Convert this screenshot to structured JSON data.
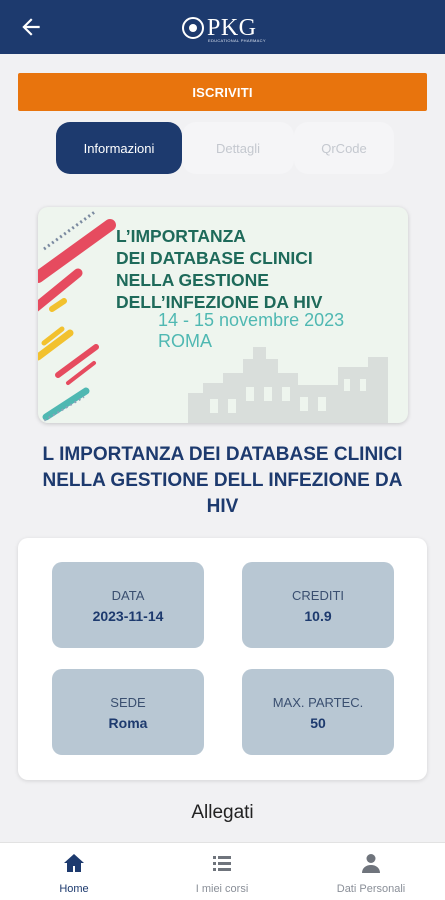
{
  "header": {
    "logo_text": "PKG",
    "logo_subtitle": "EDUCATIONAL PHARMACY"
  },
  "cta": {
    "label": "ISCRIVITI"
  },
  "tabs": [
    {
      "label": "Informazioni",
      "active": true
    },
    {
      "label": "Dettagli",
      "active": false
    },
    {
      "label": "QrCode",
      "active": false
    }
  ],
  "banner": {
    "title_lines": [
      "L’IMPORTANZA",
      "DEI DATABASE CLINICI",
      "NELLA GESTIONE",
      "DELL’INFEZIONE DA HIV"
    ],
    "date": "14 - 15 novembre 2023",
    "city": "ROMA"
  },
  "course": {
    "title": "L IMPORTANZA DEI DATABASE CLINICI NELLA GESTIONE DELL INFEZIONE DA HIV"
  },
  "info": {
    "date": {
      "label": "DATA",
      "value": "2023-11-14"
    },
    "credits": {
      "label": "CREDITI",
      "value": "10.9"
    },
    "venue": {
      "label": "SEDE",
      "value": "Roma"
    },
    "max_participants": {
      "label": "MAX. PARTEC.",
      "value": "50"
    }
  },
  "attachments": {
    "title": "Allegati"
  },
  "bottom_nav": [
    {
      "label": "Home",
      "icon": "home-icon",
      "active": true
    },
    {
      "label": "I miei corsi",
      "icon": "list-icon",
      "active": false
    },
    {
      "label": "Dati Personali",
      "icon": "person-icon",
      "active": false
    }
  ],
  "colors": {
    "primary": "#1d3a6e",
    "accent": "#e8740d",
    "tile_bg": "#b8c7d3",
    "banner_title": "#1e6a5a",
    "banner_date": "#4fb8b2"
  }
}
